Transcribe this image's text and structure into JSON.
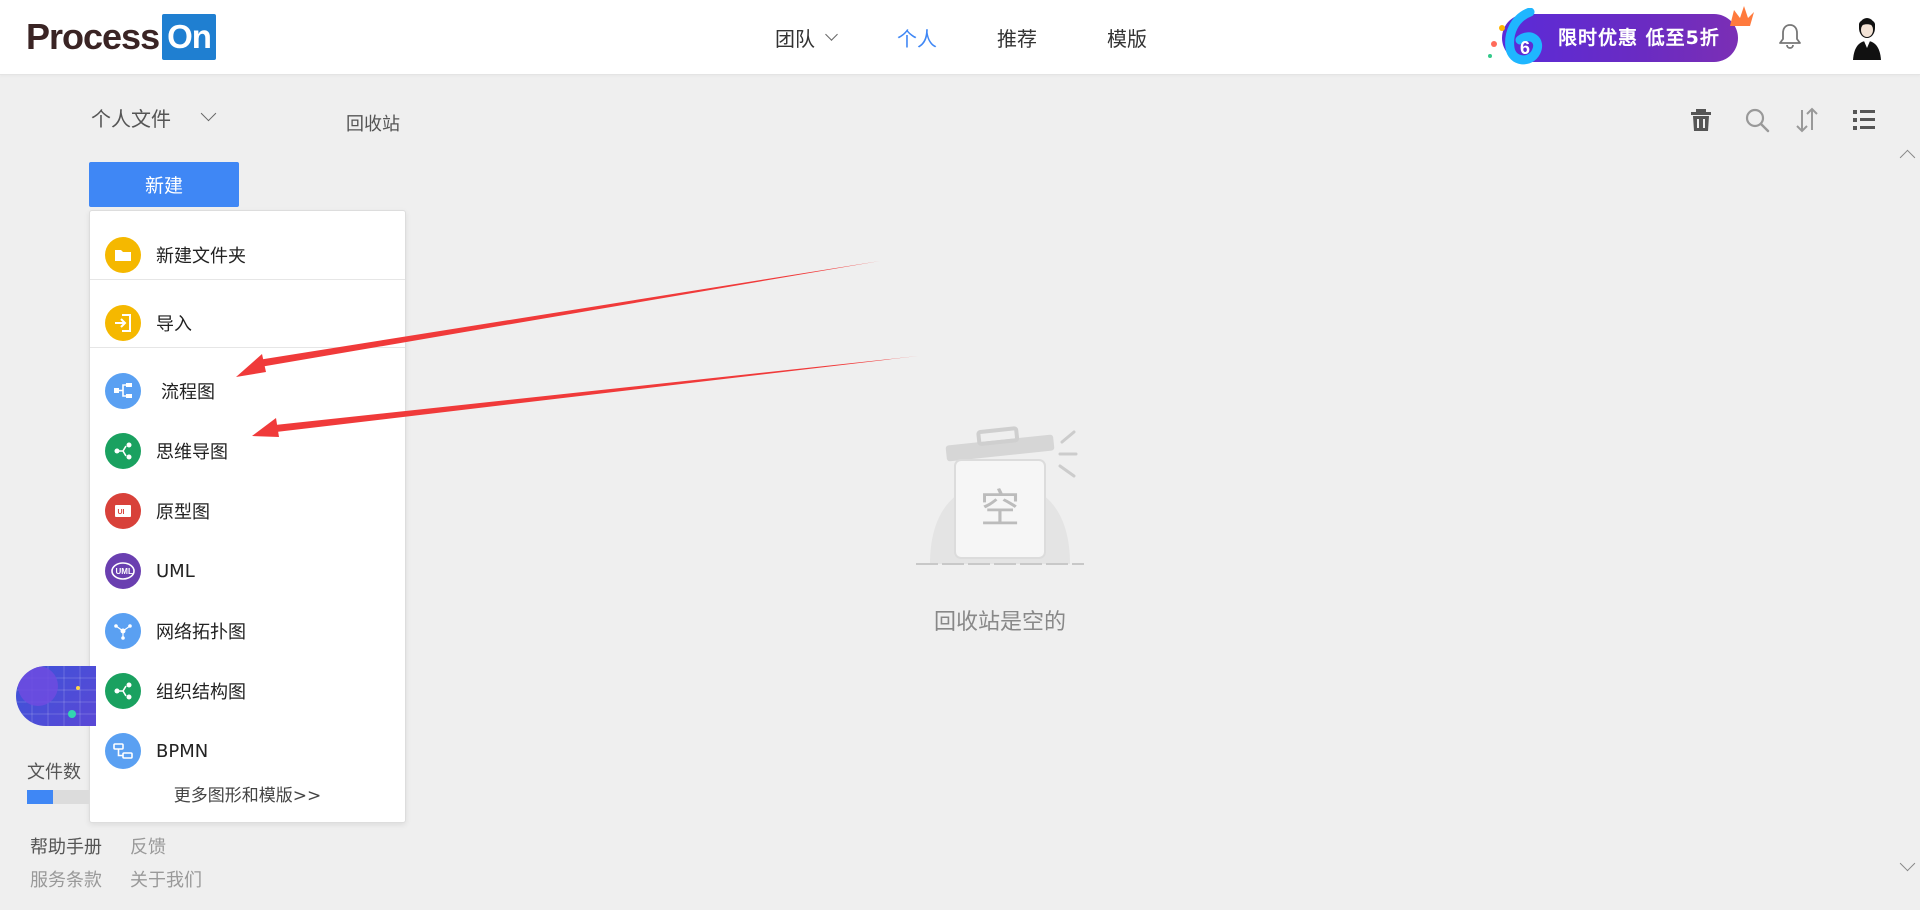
{
  "header": {
    "logo_process": "Process",
    "logo_on": "On",
    "nav": [
      {
        "label": "团队",
        "has_dropdown": true,
        "active": false
      },
      {
        "label": "个人",
        "has_dropdown": false,
        "active": true
      },
      {
        "label": "推荐",
        "has_dropdown": false,
        "active": false
      },
      {
        "label": "模版",
        "has_dropdown": false,
        "active": false
      }
    ],
    "promo_text": "限时优惠  低至5折",
    "promo_number": "6",
    "bell_icon": "bell-icon",
    "avatar_icon": "avatar"
  },
  "toolbar": {
    "folder_select": "个人文件",
    "recycle_tab": "回收站",
    "icons": [
      "trash-icon",
      "search-icon",
      "sort-icon",
      "list-view-icon"
    ]
  },
  "new_menu": {
    "button_label": "新建",
    "items": [
      {
        "label": "新建文件夹",
        "icon": "folder-icon",
        "color": "#f5b800"
      },
      {
        "label": "导入",
        "icon": "import-icon",
        "color": "#f5b800"
      },
      {
        "label": "流程图",
        "icon": "flowchart-icon",
        "color": "#5aa0f2"
      },
      {
        "label": "思维导图",
        "icon": "mindmap-icon",
        "color": "#1aa160"
      },
      {
        "label": "原型图",
        "icon": "prototype-icon",
        "color": "#d8413a"
      },
      {
        "label": "UML",
        "icon": "uml-icon",
        "color": "#6a3fb0"
      },
      {
        "label": "网络拓扑图",
        "icon": "network-icon",
        "color": "#5aa0f2"
      },
      {
        "label": "组织结构图",
        "icon": "org-chart-icon",
        "color": "#1aa160"
      },
      {
        "label": "BPMN",
        "icon": "bpmn-icon",
        "color": "#5aa0f2"
      }
    ],
    "more_link": "更多图形和模版>>"
  },
  "empty_state": {
    "badge_char": "空",
    "message": "回收站是空的"
  },
  "sidebar": {
    "file_count_label": "文件数",
    "file_count_progress": 0.42,
    "links": [
      "帮助手册",
      "反馈",
      "服务条款",
      "关于我们"
    ]
  },
  "colors": {
    "accent": "#3f87f5",
    "annotation_arrow": "#f03a3a"
  }
}
